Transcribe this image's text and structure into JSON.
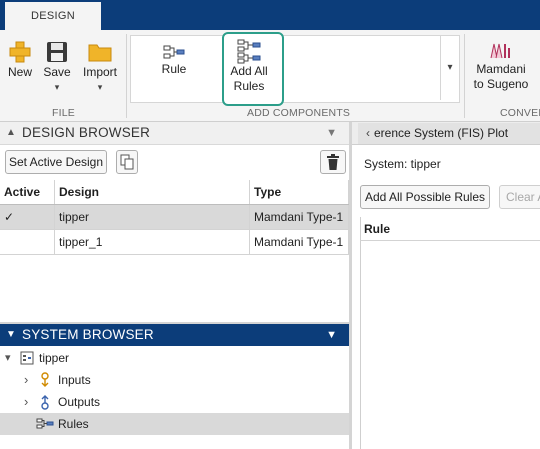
{
  "tabs": {
    "active": "DESIGN"
  },
  "toolstrip": {
    "new_label": "New",
    "save_label": "Save",
    "import_label": "Import",
    "file_section": "FILE",
    "rule_label": "Rule",
    "add_all_line1": "Add All",
    "add_all_line2": "Rules",
    "add_components_section": "ADD COMPONENTS",
    "convert_line1": "Mamdani",
    "convert_line2": "to Sugeno",
    "convert_section": "CONVER",
    "dropdown_arrow": "▾",
    "gallery_arrow": "▾",
    "highlight_color": "#2c9e8a"
  },
  "design_browser": {
    "title": "DESIGN BROWSER",
    "collapse_glyph": "▲",
    "menu_glyph": "▼",
    "set_active_button": "Set Active Design",
    "columns": [
      "Active",
      "Design",
      "Type"
    ],
    "rows": [
      {
        "active": "✓",
        "design": "tipper",
        "type": "Mamdani Type-1",
        "selected": true
      },
      {
        "active": "",
        "design": "tipper_1",
        "type": "Mamdani Type-1",
        "selected": false
      }
    ]
  },
  "system_browser": {
    "title": "SYSTEM BROWSER",
    "collapse_glyph": "▼",
    "menu_glyph": "▼",
    "root": "tipper",
    "root_toggle": "▾",
    "children": [
      {
        "label": "Inputs",
        "toggle": "›"
      },
      {
        "label": "Outputs",
        "toggle": "›"
      },
      {
        "label": "Rules",
        "toggle": "",
        "selected": true
      }
    ]
  },
  "rule_panel": {
    "tab_label": "erence System (FIS) Plot",
    "tab_chevron": "‹",
    "system_label": "System: tipper",
    "add_all_possible_button": "Add All Possible Rules",
    "clear_button": "Clear A",
    "rule_column": "Rule"
  },
  "colors": {
    "titlebar": "#0c3d7a",
    "selection": "#d9d9d9"
  }
}
